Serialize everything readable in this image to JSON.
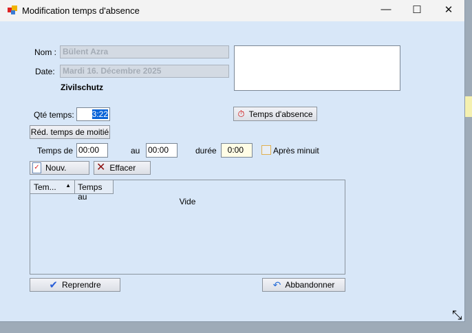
{
  "window": {
    "title": "Modification temps d'absence",
    "minimize": "—",
    "maximize": "☐",
    "close": "✕"
  },
  "form": {
    "nom_label": "Nom :",
    "nom_value": "Bülent Azra",
    "date_label": "Date:",
    "date_value": "Mardi 16. Décembre 2025",
    "category": "Zivilschutz",
    "qte_label": "Qté temps:",
    "qte_value": "3:22",
    "absence_button": "Temps d'absence",
    "half_button": "Réd. temps de moitié",
    "from_label": "Temps de",
    "from_value": "00:00",
    "to_label": "au",
    "to_value": "00:00",
    "duration_label": "durée",
    "duration_value": "0:00",
    "after_midnight_label": "Après minuit",
    "after_midnight_checked": false,
    "new_button": "Nouv.",
    "delete_button": "Effacer"
  },
  "list": {
    "columns": [
      "Tem...",
      "Temps au"
    ],
    "empty_text": "Vide"
  },
  "footer": {
    "ok_button": "Reprendre",
    "cancel_button": "Abbandonner"
  }
}
